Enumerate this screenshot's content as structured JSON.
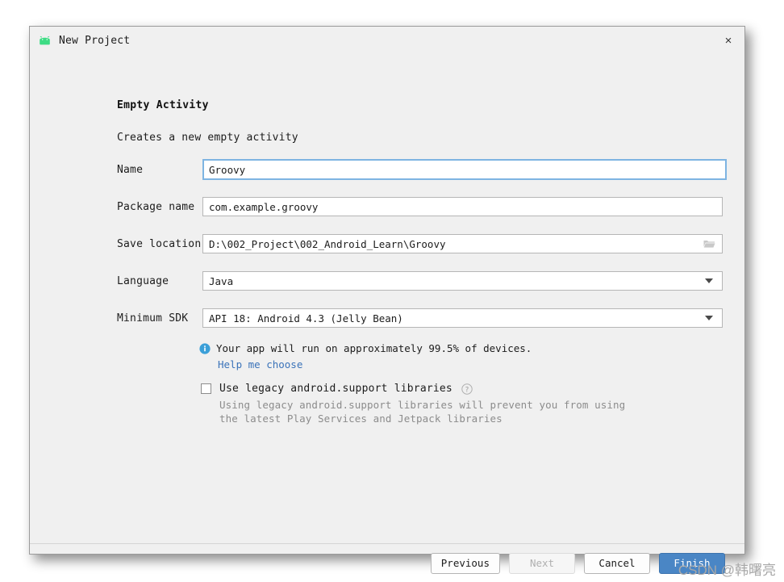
{
  "window": {
    "title": "New Project",
    "app_icon": "android-icon",
    "close_label": "×"
  },
  "content": {
    "heading": "Empty Activity",
    "subheading": "Creates a new empty activity"
  },
  "form": {
    "fields": [
      {
        "label": "Name",
        "value": "Groovy",
        "type": "text",
        "focused": true
      },
      {
        "label": "Package name",
        "value": "com.example.groovy",
        "type": "text",
        "focused": false
      },
      {
        "label": "Save location",
        "value": "D:\\002_Project\\002_Android_Learn\\Groovy",
        "type": "path",
        "focused": false,
        "icon": "folder-icon"
      },
      {
        "label": "Language",
        "value": "Java",
        "type": "select",
        "focused": false,
        "icon": "chevron-down-icon"
      },
      {
        "label": "Minimum SDK",
        "value": "API 18: Android 4.3 (Jelly Bean)",
        "type": "select",
        "focused": false,
        "icon": "chevron-down-icon"
      }
    ]
  },
  "sdk_info": {
    "icon": "info-icon",
    "text": "Your app will run on approximately 99.5% of devices.",
    "link": "Help me choose"
  },
  "legacy": {
    "checked": false,
    "label": "Use legacy android.support libraries",
    "help_icon": "question-mark-icon",
    "description_line1": "Using legacy android.support libraries will prevent you from using",
    "description_line2": "the latest Play Services and Jetpack libraries"
  },
  "footer": {
    "buttons": [
      {
        "label": "Previous",
        "state": "enabled"
      },
      {
        "label": "Next",
        "state": "disabled"
      },
      {
        "label": "Cancel",
        "state": "enabled"
      },
      {
        "label": "Finish",
        "state": "primary"
      }
    ]
  },
  "watermark": "CSDN @韩曙亮",
  "colors": {
    "accent": "#4a86c5",
    "link": "#3b73b9",
    "focus_border": "#7eb4e2",
    "android_green": "#3ddc84",
    "info_blue": "#3b9fd8"
  }
}
